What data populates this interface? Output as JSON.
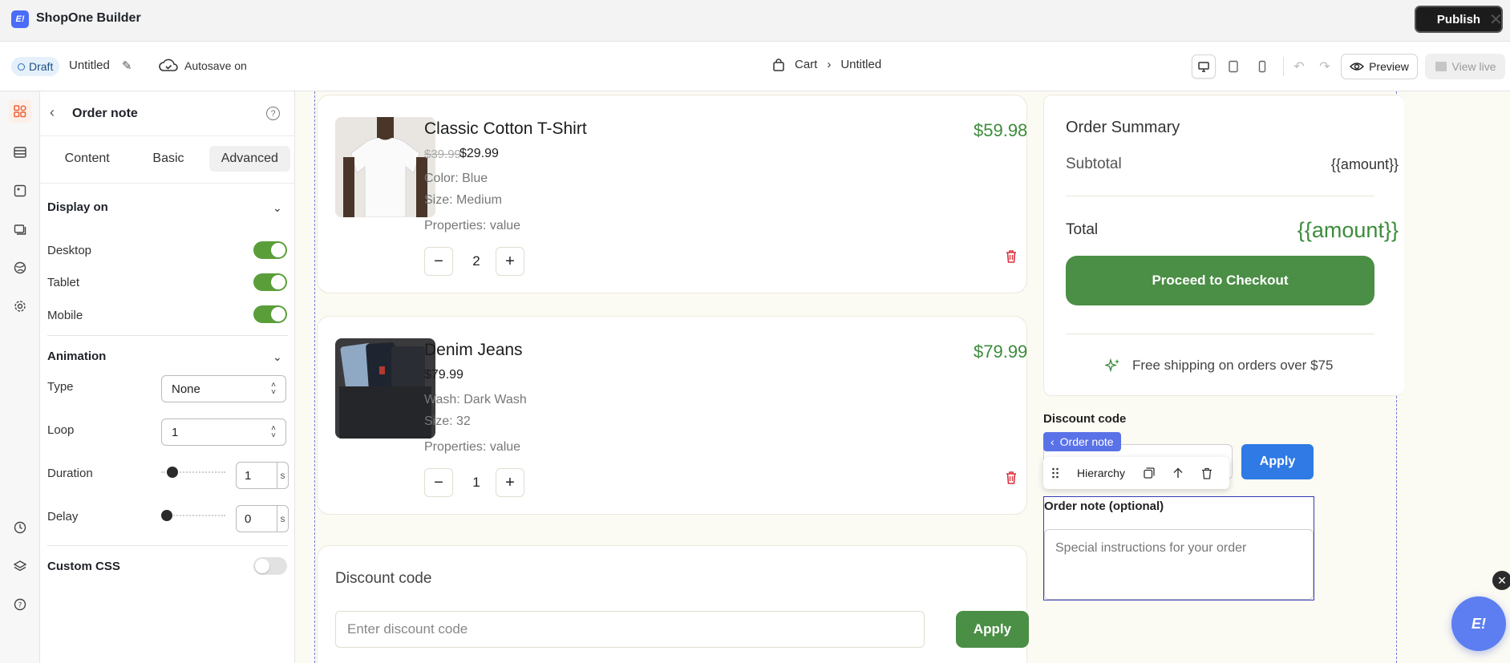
{
  "app": {
    "title": "ShopOne Builder",
    "logo_icon": "shopone-logo-icon",
    "publish_label": "Publish"
  },
  "toolbar": {
    "status": "Draft",
    "doc_name": "Untitled",
    "autosave": "Autosave on",
    "breadcrumb": [
      "Cart",
      "Untitled"
    ],
    "preview_label": "Preview",
    "view_live_label": "View live"
  },
  "panel": {
    "title": "Order note",
    "tabs": [
      "Content",
      "Basic",
      "Advanced"
    ],
    "active_tab": "Advanced",
    "display_on": {
      "heading": "Display on",
      "items": [
        {
          "label": "Desktop",
          "on": true
        },
        {
          "label": "Tablet",
          "on": true
        },
        {
          "label": "Mobile",
          "on": true
        }
      ]
    },
    "animation": {
      "heading": "Animation",
      "type_label": "Type",
      "type_value": "None",
      "loop_label": "Loop",
      "loop_value": "1",
      "duration_label": "Duration",
      "duration_value": "1",
      "duration_unit": "s",
      "delay_label": "Delay",
      "delay_value": "0",
      "delay_unit": "s"
    },
    "custom_css": {
      "label": "Custom CSS",
      "on": false
    }
  },
  "cart": {
    "items": [
      {
        "name": "Classic Cotton T-Shirt",
        "old_price": "$39.99",
        "price": "$29.99",
        "meta": [
          "Color: Blue",
          "Size: Medium",
          "Properties: value"
        ],
        "qty": "2",
        "line_total": "$59.98"
      },
      {
        "name": "Denim Jeans",
        "price": "$79.99",
        "meta": [
          "Wash: Dark Wash",
          "Size: 32",
          "Properties: value"
        ],
        "qty": "1",
        "line_total": "$79.99"
      }
    ],
    "discount": {
      "title": "Discount code",
      "placeholder": "Enter discount code",
      "apply": "Apply"
    }
  },
  "summary": {
    "title": "Order Summary",
    "subtotal_label": "Subtotal",
    "subtotal_value": "{{amount}}",
    "total_label": "Total",
    "total_value": "{{amount}}",
    "checkout_label": "Proceed to Checkout",
    "shipping_text": "Free shipping on orders over $75"
  },
  "sidebar_widget": {
    "discount_label": "Discount code",
    "apply_label": "Apply",
    "chip_label": "Order note",
    "hierarchy_label": "Hierarchy",
    "order_note_label": "Order note (optional)",
    "order_note_placeholder": "Special instructions for your order"
  },
  "colors": {
    "accent_green": "#4b8e46",
    "select_blue": "#5a72e8",
    "apply_blue": "#2f7ae5"
  }
}
